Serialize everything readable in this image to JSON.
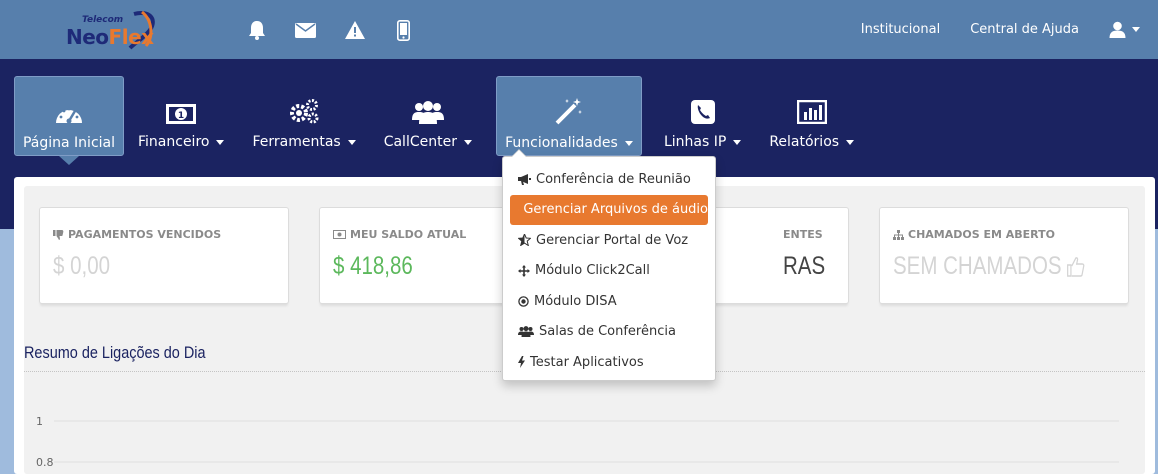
{
  "colors": {
    "topbar": "#577fac",
    "nav_band": "#1b2361",
    "accent_orange": "#e8792f",
    "value_green": "#5cb85c",
    "muted_value": "#d4d4d4"
  },
  "brand": {
    "telecom": "Telecom",
    "name_part1": "Neo",
    "name_part2": "Flex"
  },
  "top_icons": [
    "bell-icon",
    "envelope-icon",
    "warning-icon",
    "mobile-icon"
  ],
  "top_links": {
    "institucional": "Institucional",
    "ajuda": "Central de Ajuda"
  },
  "nav": [
    {
      "label": "Página Inicial",
      "icon": "dashboard-icon",
      "active": true
    },
    {
      "label": "Financeiro",
      "icon": "money-icon"
    },
    {
      "label": "Ferramentas",
      "icon": "gears-icon"
    },
    {
      "label": "CallCenter",
      "icon": "users-icon"
    },
    {
      "label": "Funcionalidades",
      "icon": "magic-wand-icon",
      "open": true
    },
    {
      "label": "Linhas IP",
      "icon": "phone-icon"
    },
    {
      "label": "Relatórios",
      "icon": "bar-chart-icon"
    }
  ],
  "dropdown": [
    {
      "label": "Conferência de Reunião",
      "icon": "bullhorn-icon"
    },
    {
      "label": "Gerenciar Arquivos de áudio",
      "icon": "volume-icon",
      "highlighted": true
    },
    {
      "label": "Gerenciar Portal de Voz",
      "icon": "star-half-icon"
    },
    {
      "label": "Módulo Click2Call",
      "icon": "arrows-icon"
    },
    {
      "label": "Módulo DISA",
      "icon": "dot-circle-icon"
    },
    {
      "label": "Salas de Conferência",
      "icon": "users-icon"
    },
    {
      "label": "Testar Aplicativos",
      "icon": "bolt-icon"
    }
  ],
  "cards": [
    {
      "title": "PAGAMENTOS VENCIDOS",
      "value": "$ 0,00"
    },
    {
      "title": "MEU SALDO ATUAL",
      "value": "$ 418,86"
    },
    {
      "title": "ENTES",
      "value": "RAS"
    },
    {
      "title": "CHAMADOS EM ABERTO",
      "value": "SEM CHAMADOS"
    }
  ],
  "section_title": "Resumo de Ligações do Dia",
  "chart_data": {
    "type": "line",
    "y_ticks": [
      "1",
      "0.8"
    ],
    "ylim": [
      0.8,
      1
    ],
    "series": []
  }
}
